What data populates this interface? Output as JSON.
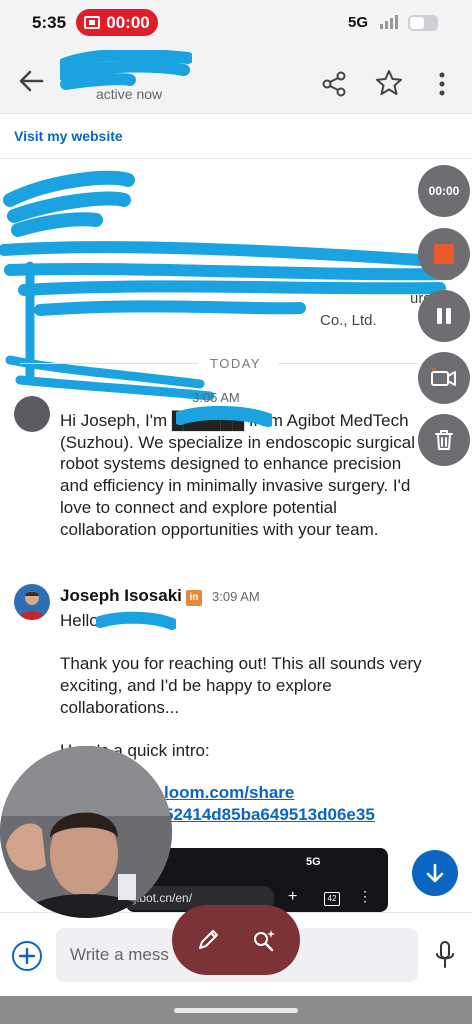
{
  "status_bar": {
    "time": "5:35",
    "record_timer": "00:00",
    "network": "5G"
  },
  "header": {
    "active_status": "active now"
  },
  "profile": {
    "visit_link": "Visit my website",
    "company_suffix": "Co., Ltd.",
    "headline_fragment": "urgical"
  },
  "divider": {
    "today": "TODAY"
  },
  "messages": [
    {
      "time": "3:05 AM",
      "body": "Hi Joseph, I'm ██████ from Agibot MedTech (Suzhou). We specialize in endoscopic surgical robot systems designed to enhance precision and efficiency in minimally invasive surgery. I'd love to connect and explore potential collaboration opportunities with your team."
    },
    {
      "sender": "Joseph Isosaki",
      "badge": "in",
      "time": "3:09 AM",
      "greeting": "Hello",
      "para1": "Thank you for reaching out! This all sounds very exciting, and I'd be happy to explore collaborations...",
      "para2": "Here's a quick intro:",
      "link_line1": "loom.com/share",
      "link_line2": "52414d85ba649513d06e35"
    }
  ],
  "preview": {
    "network": "5G",
    "url": "gibot.cn/en/",
    "tabs": "42"
  },
  "recorder": {
    "timer": "00:00"
  },
  "composer": {
    "placeholder": "Write a mess"
  },
  "colors": {
    "accent": "#0a66c2",
    "record_red": "#e11d2a",
    "redaction": "#1aa3e0",
    "stop": "#ea5a2a"
  }
}
